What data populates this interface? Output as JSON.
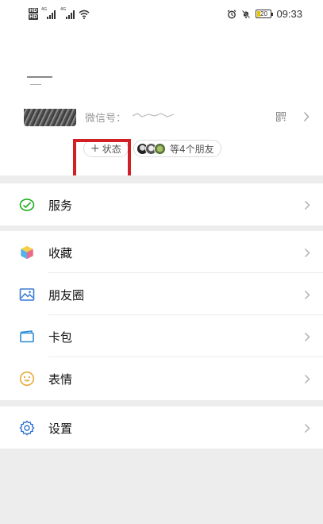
{
  "status_bar": {
    "hd_labels": [
      "HD",
      "HD"
    ],
    "net_1": "4G",
    "net_2": "4G",
    "battery": "20",
    "time": "09:33"
  },
  "profile": {
    "wechat_id_label": "微信号：",
    "status_button": "状态",
    "friends_text": "等4个朋友"
  },
  "menu": {
    "services": "服务",
    "favorites": "收藏",
    "moments": "朋友圈",
    "cards": "卡包",
    "stickers": "表情",
    "settings": "设置"
  },
  "colors": {
    "highlight_box": "#d21f26",
    "services_icon": "#1aad19",
    "moments_icon": "#3a7bd5",
    "cards_icon": "#2d8cd6",
    "stickers_icon": "#e7a93a",
    "settings_icon": "#2d6fcf"
  }
}
